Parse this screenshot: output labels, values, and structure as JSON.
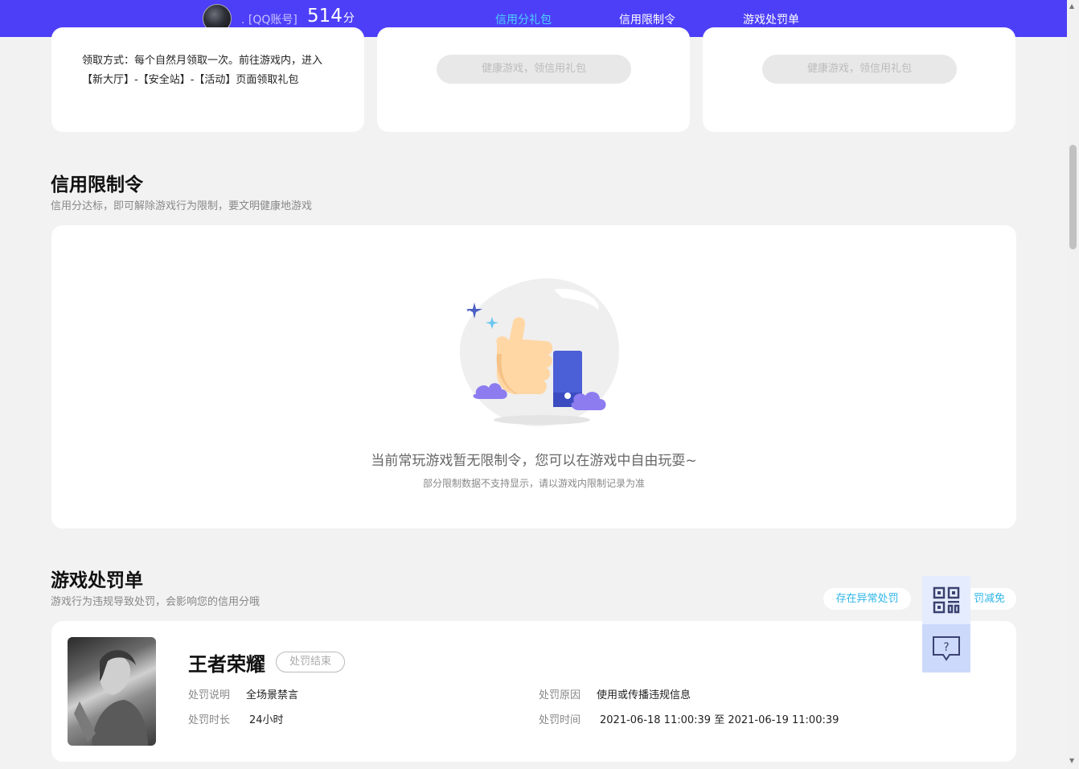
{
  "header": {
    "account_label": ". [QQ账号]",
    "score": "514",
    "score_unit": "分",
    "tabs": [
      {
        "label": "信用分礼包",
        "active": true
      },
      {
        "label": "信用限制令",
        "active": false
      },
      {
        "label": "游戏处罚单",
        "active": false
      }
    ]
  },
  "gift": {
    "desc": "领取方式：每个自然月领取一次。前往游戏内，进入【新大厅】-【安全站】-【活动】页面领取礼包",
    "button_label": "健康游戏，领信用礼包"
  },
  "restriction": {
    "title": "信用限制令",
    "subtitle": "信用分达标，即可解除游戏行为限制，要文明健康地游戏",
    "empty_text": "当前常玩游戏暂无限制令，您可以在游戏中自由玩耍~",
    "empty_note": "部分限制数据不支持显示，请以游戏内限制记录为准"
  },
  "penalty": {
    "title": "游戏处罚单",
    "subtitle": "游戏行为违规导致处罚，会影响您的信用分哦",
    "report_button": "存在异常处罚",
    "reduce_button": "罚减免",
    "record": {
      "game": "王者荣耀",
      "status": "处罚结束",
      "desc_label": "处罚说明",
      "desc_value": "全场景禁言",
      "duration_label": "处罚时长",
      "duration_value": "24小时",
      "reason_label": "处罚原因",
      "reason_value": "使用或传播违规信息",
      "time_label": "处罚时间",
      "time_value": "2021-06-18 11:00:39 至 2021-06-19 11:00:39"
    }
  },
  "float_tools": [
    "qr-code-icon",
    "help-chat-icon"
  ],
  "colors": {
    "brand": "#4d3ff7",
    "active_tab": "#4fd0ff",
    "link": "#2fb6e8",
    "page_bg": "#f2f2f2"
  }
}
